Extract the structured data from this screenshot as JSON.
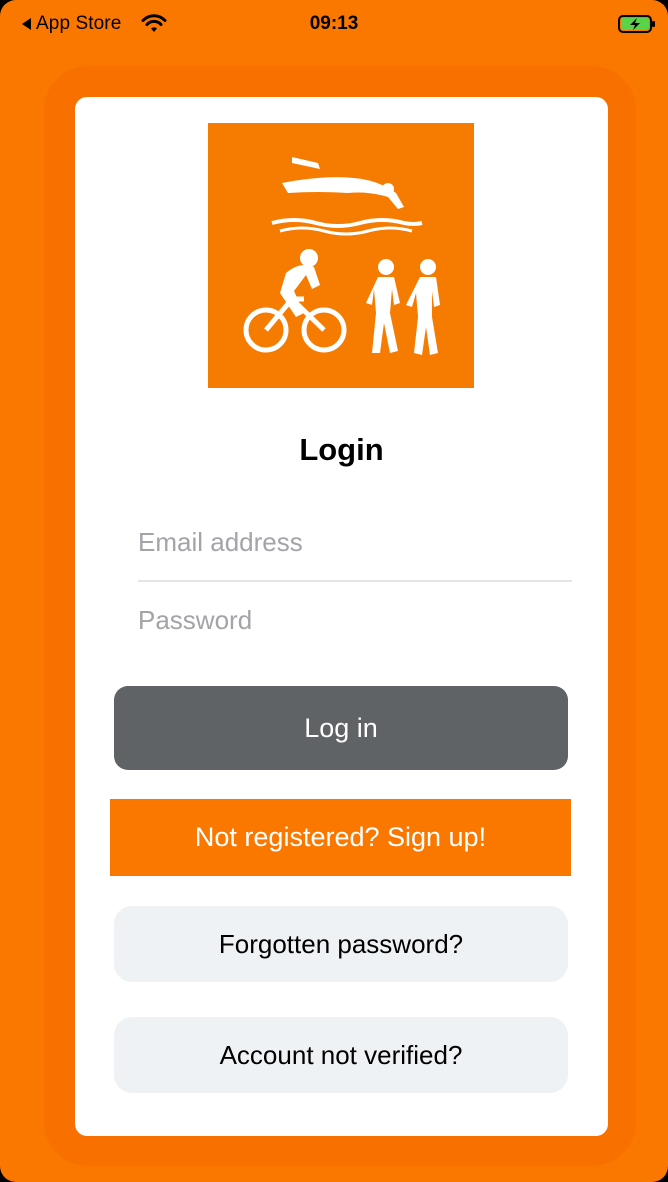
{
  "status_bar": {
    "back_label": "App Store",
    "time": "09:13"
  },
  "login": {
    "heading": "Login",
    "email_placeholder": "Email address",
    "password_placeholder": "Password",
    "login_button": "Log in",
    "signup_button": "Not registered? Sign up!",
    "forgot_button": "Forgotten password?",
    "verify_button": "Account not verified?"
  },
  "icons": {
    "logo": "triathlon-logo-icon",
    "wifi": "wifi-icon",
    "battery": "battery-charging-icon",
    "back": "back-arrow-icon"
  },
  "colors": {
    "background": "#FA7800",
    "card": "#FFFFFF",
    "logo": "#F57C00",
    "login_button": "#606366",
    "signup_button": "#FA7800",
    "secondary_button": "#EFF2F4",
    "placeholder": "#A3A3A8",
    "battery_fill": "#5BD348"
  }
}
